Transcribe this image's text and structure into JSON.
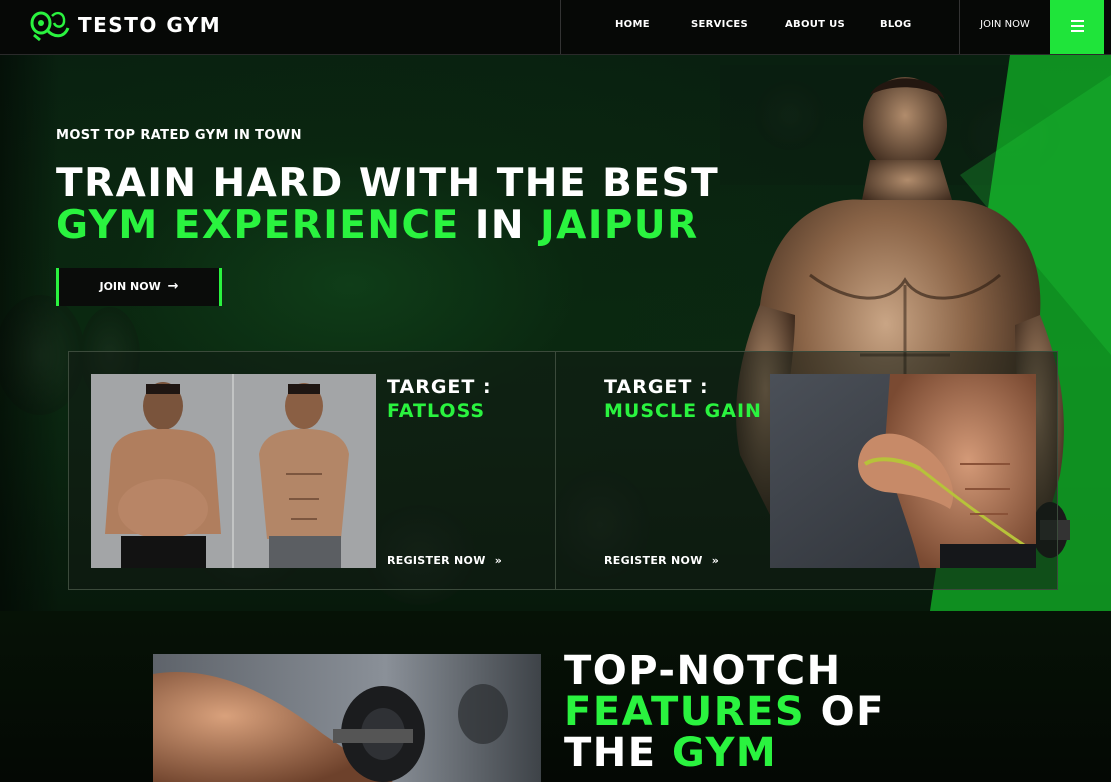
{
  "brand": {
    "name": "TESTO GYM",
    "logo_icon": "dumbbell-gym-logo",
    "accent": "#2af33f"
  },
  "nav": {
    "items": [
      {
        "label": "HOME"
      },
      {
        "label": "SERVICES"
      },
      {
        "label": "ABOUT US"
      },
      {
        "label": "BLOG"
      }
    ],
    "join_label": "JOIN NOW",
    "menu_icon": "hamburger-icon"
  },
  "hero": {
    "tagline": "MOST TOP RATED GYM IN TOWN",
    "headline_line1": "TRAIN HARD WITH THE BEST",
    "headline_line2_a": "GYM EXPERIENCE",
    "headline_line2_b": " IN ",
    "headline_line2_c": "JAIPUR",
    "cta_label": "JOIN NOW",
    "cta_icon": "arrow-right-icon"
  },
  "cards": [
    {
      "title_prefix": "TARGET :",
      "title_highlight": "FATLOSS",
      "register_label": "REGISTER NOW",
      "register_icon": "double-chevron-right-icon"
    },
    {
      "title_prefix": "TARGET :",
      "title_highlight": "MUSCLE GAIN",
      "register_label": "REGISTER NOW",
      "register_icon": "double-chevron-right-icon"
    }
  ],
  "features": {
    "title_line1": "TOP-NOTCH",
    "title_line2_a": "FEATURES",
    "title_line2_b": " OF",
    "title_line3_a": "THE ",
    "title_line3_b": "GYM"
  }
}
